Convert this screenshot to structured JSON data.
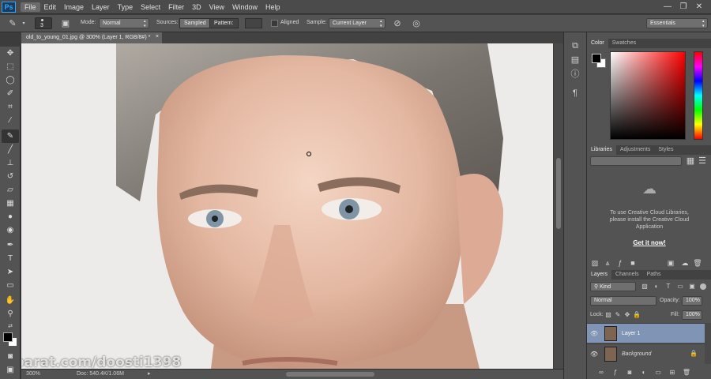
{
  "app": {
    "logo": "Ps"
  },
  "menubar": {
    "items": [
      "File",
      "Edit",
      "Image",
      "Layer",
      "Type",
      "Select",
      "Filter",
      "3D",
      "View",
      "Window",
      "Help"
    ],
    "active": "File"
  },
  "window_controls": {
    "minimize": "—",
    "maximize": "❐",
    "close": "✕"
  },
  "options": {
    "brush_size": "3",
    "mode_label": "Mode:",
    "mode_value": "Normal",
    "sources_label": "Sources:",
    "sampled": "Sampled",
    "pattern": "Pattern:",
    "aligned_label": "Aligned",
    "sample_label": "Sample:",
    "sample_value": "Current Layer",
    "workspace": "Essentials"
  },
  "document": {
    "tab_title": "old_to_young_01.jpg @ 300% (Layer 1, RGB/8#) *",
    "tab_close": "×",
    "zoom": "300%",
    "doc_info": "Doc: 540.4K/1.06M"
  },
  "color_panel": {
    "tabs": [
      "Color",
      "Swatches"
    ],
    "active": "Color"
  },
  "libraries_panel": {
    "tabs": [
      "Libraries",
      "Adjustments",
      "Styles"
    ],
    "active": "Libraries",
    "message": "To use Creative Cloud Libraries, please install the Creative Cloud Application",
    "cta": "Get it now!"
  },
  "layers_panel": {
    "tabs": [
      "Layers",
      "Channels",
      "Paths"
    ],
    "active": "Layers",
    "filter_kind": "Kind",
    "blend_mode": "Normal",
    "opacity_label": "Opacity:",
    "opacity_value": "100%",
    "lock_label": "Lock:",
    "fill_label": "Fill:",
    "fill_value": "100%",
    "layers": [
      {
        "name": "Layer 1",
        "selected": true
      },
      {
        "name": "Background",
        "selected": false
      }
    ]
  },
  "watermark": {
    "text": "aparat.com/doosti1398"
  },
  "colors": {
    "accent_selected_layer": "#8094b5",
    "foreground": "#000000",
    "background": "#ffffff"
  }
}
